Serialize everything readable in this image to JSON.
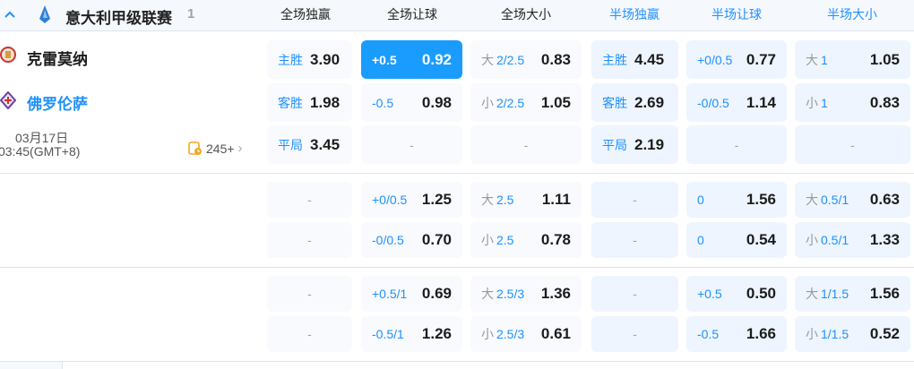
{
  "league": {
    "name": "意大利甲级联赛",
    "count": "1"
  },
  "headers": [
    "全场独赢",
    "全场让球",
    "全场大小",
    "半场独赢",
    "半场让球",
    "半场大小"
  ],
  "match": {
    "home": "克雷莫纳",
    "away": "佛罗伦萨",
    "date": "03月17日",
    "time": "03:45(GMT+8)",
    "more": "245+"
  },
  "colors": {
    "accent": "#1a9cff",
    "half_header": "#1e90ff"
  },
  "groups": [
    [
      [
        {
          "label": "主胜",
          "odds": "3.90"
        },
        {
          "line": "+0.5",
          "odds": "0.92",
          "selected": true
        },
        {
          "side": "大",
          "line": "2/2.5",
          "odds": "0.83"
        },
        {
          "label": "主胜",
          "odds": "4.45"
        },
        {
          "line": "+0/0.5",
          "odds": "0.77"
        },
        {
          "side": "大",
          "line": "1",
          "odds": "1.05"
        }
      ],
      [
        {
          "label": "客胜",
          "odds": "1.98"
        },
        {
          "line": "-0.5",
          "odds": "0.98"
        },
        {
          "side": "小",
          "line": "2/2.5",
          "odds": "1.05"
        },
        {
          "label": "客胜",
          "odds": "2.69"
        },
        {
          "line": "-0/0.5",
          "odds": "1.14"
        },
        {
          "side": "小",
          "line": "1",
          "odds": "0.83"
        }
      ],
      [
        {
          "label": "平局",
          "odds": "3.45"
        },
        {
          "empty": "-"
        },
        {
          "empty": "-"
        },
        {
          "label": "平局",
          "odds": "2.19"
        },
        {
          "empty": "-"
        },
        {
          "empty": "-"
        }
      ]
    ],
    [
      [
        {
          "empty": "-"
        },
        {
          "line": "+0/0.5",
          "odds": "1.25"
        },
        {
          "side": "大",
          "line": "2.5",
          "odds": "1.11"
        },
        {
          "empty": "-"
        },
        {
          "line": "0",
          "odds": "1.56"
        },
        {
          "side": "大",
          "line": "0.5/1",
          "odds": "0.63"
        }
      ],
      [
        {
          "empty": "-"
        },
        {
          "line": "-0/0.5",
          "odds": "0.70"
        },
        {
          "side": "小",
          "line": "2.5",
          "odds": "0.78"
        },
        {
          "empty": "-"
        },
        {
          "line": "0",
          "odds": "0.54"
        },
        {
          "side": "小",
          "line": "0.5/1",
          "odds": "1.33"
        }
      ]
    ],
    [
      [
        {
          "empty": "-"
        },
        {
          "line": "+0.5/1",
          "odds": "0.69"
        },
        {
          "side": "大",
          "line": "2.5/3",
          "odds": "1.36"
        },
        {
          "empty": "-"
        },
        {
          "line": "+0.5",
          "odds": "0.50"
        },
        {
          "side": "大",
          "line": "1/1.5",
          "odds": "1.56"
        }
      ],
      [
        {
          "empty": "-"
        },
        {
          "line": "-0.5/1",
          "odds": "1.26"
        },
        {
          "side": "小",
          "line": "2.5/3",
          "odds": "0.61"
        },
        {
          "empty": "-"
        },
        {
          "line": "-0.5",
          "odds": "1.66"
        },
        {
          "side": "小",
          "line": "1/1.5",
          "odds": "0.52"
        }
      ]
    ]
  ]
}
